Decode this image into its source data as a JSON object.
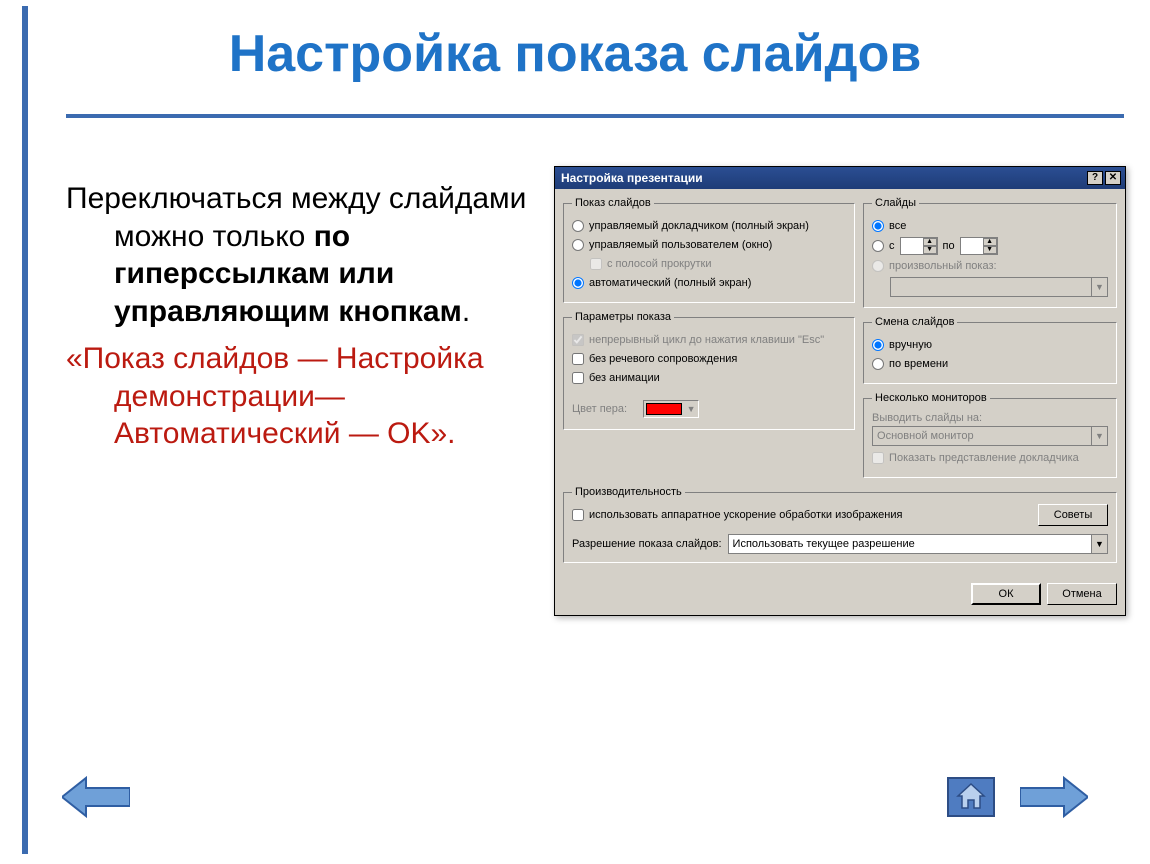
{
  "slide": {
    "title": "Настройка показа слайдов",
    "para1_a": "Переключаться между слайдами можно только ",
    "para1_b": "по гиперссылкам или управляющим кнопкам",
    "para1_c": ".",
    "para2": "«Показ слайдов — Настройка демонстрации— Автоматический — OK»."
  },
  "dialog": {
    "title": "Настройка презентации",
    "help_btn": "?",
    "close_btn": "✕",
    "groups": {
      "show_type": {
        "legend": "Показ слайдов",
        "opt1": "управляемый докладчиком (полный экран)",
        "opt2": "управляемый пользователем (окно)",
        "opt2_sub": "с полосой прокрутки",
        "opt3": "автоматический (полный экран)"
      },
      "slides": {
        "legend": "Слайды",
        "opt_all": "все",
        "opt_from": "с",
        "to_label": "по",
        "opt_custom": "произвольный показ:"
      },
      "show_opts": {
        "legend": "Параметры показа",
        "chk1": "непрерывный цикл до нажатия клавиши \"Esc\"",
        "chk2": "без речевого сопровождения",
        "chk3": "без анимации",
        "pen_label": "Цвет пера:"
      },
      "advance": {
        "legend": "Смена слайдов",
        "opt_manual": "вручную",
        "opt_timings": "по времени"
      },
      "monitors": {
        "legend": "Несколько мониторов",
        "display_on": "Выводить слайды на:",
        "primary": "Основной монитор",
        "presenter": "Показать представление докладчика"
      },
      "perf": {
        "legend": "Производительность",
        "hw_accel": "использовать аппаратное ускорение обработки изображения",
        "tips_btn": "Советы",
        "res_label": "Разрешение показа слайдов:",
        "res_value": "Использовать текущее разрешение"
      }
    },
    "buttons": {
      "ok": "ОК",
      "cancel": "Отмена"
    }
  }
}
